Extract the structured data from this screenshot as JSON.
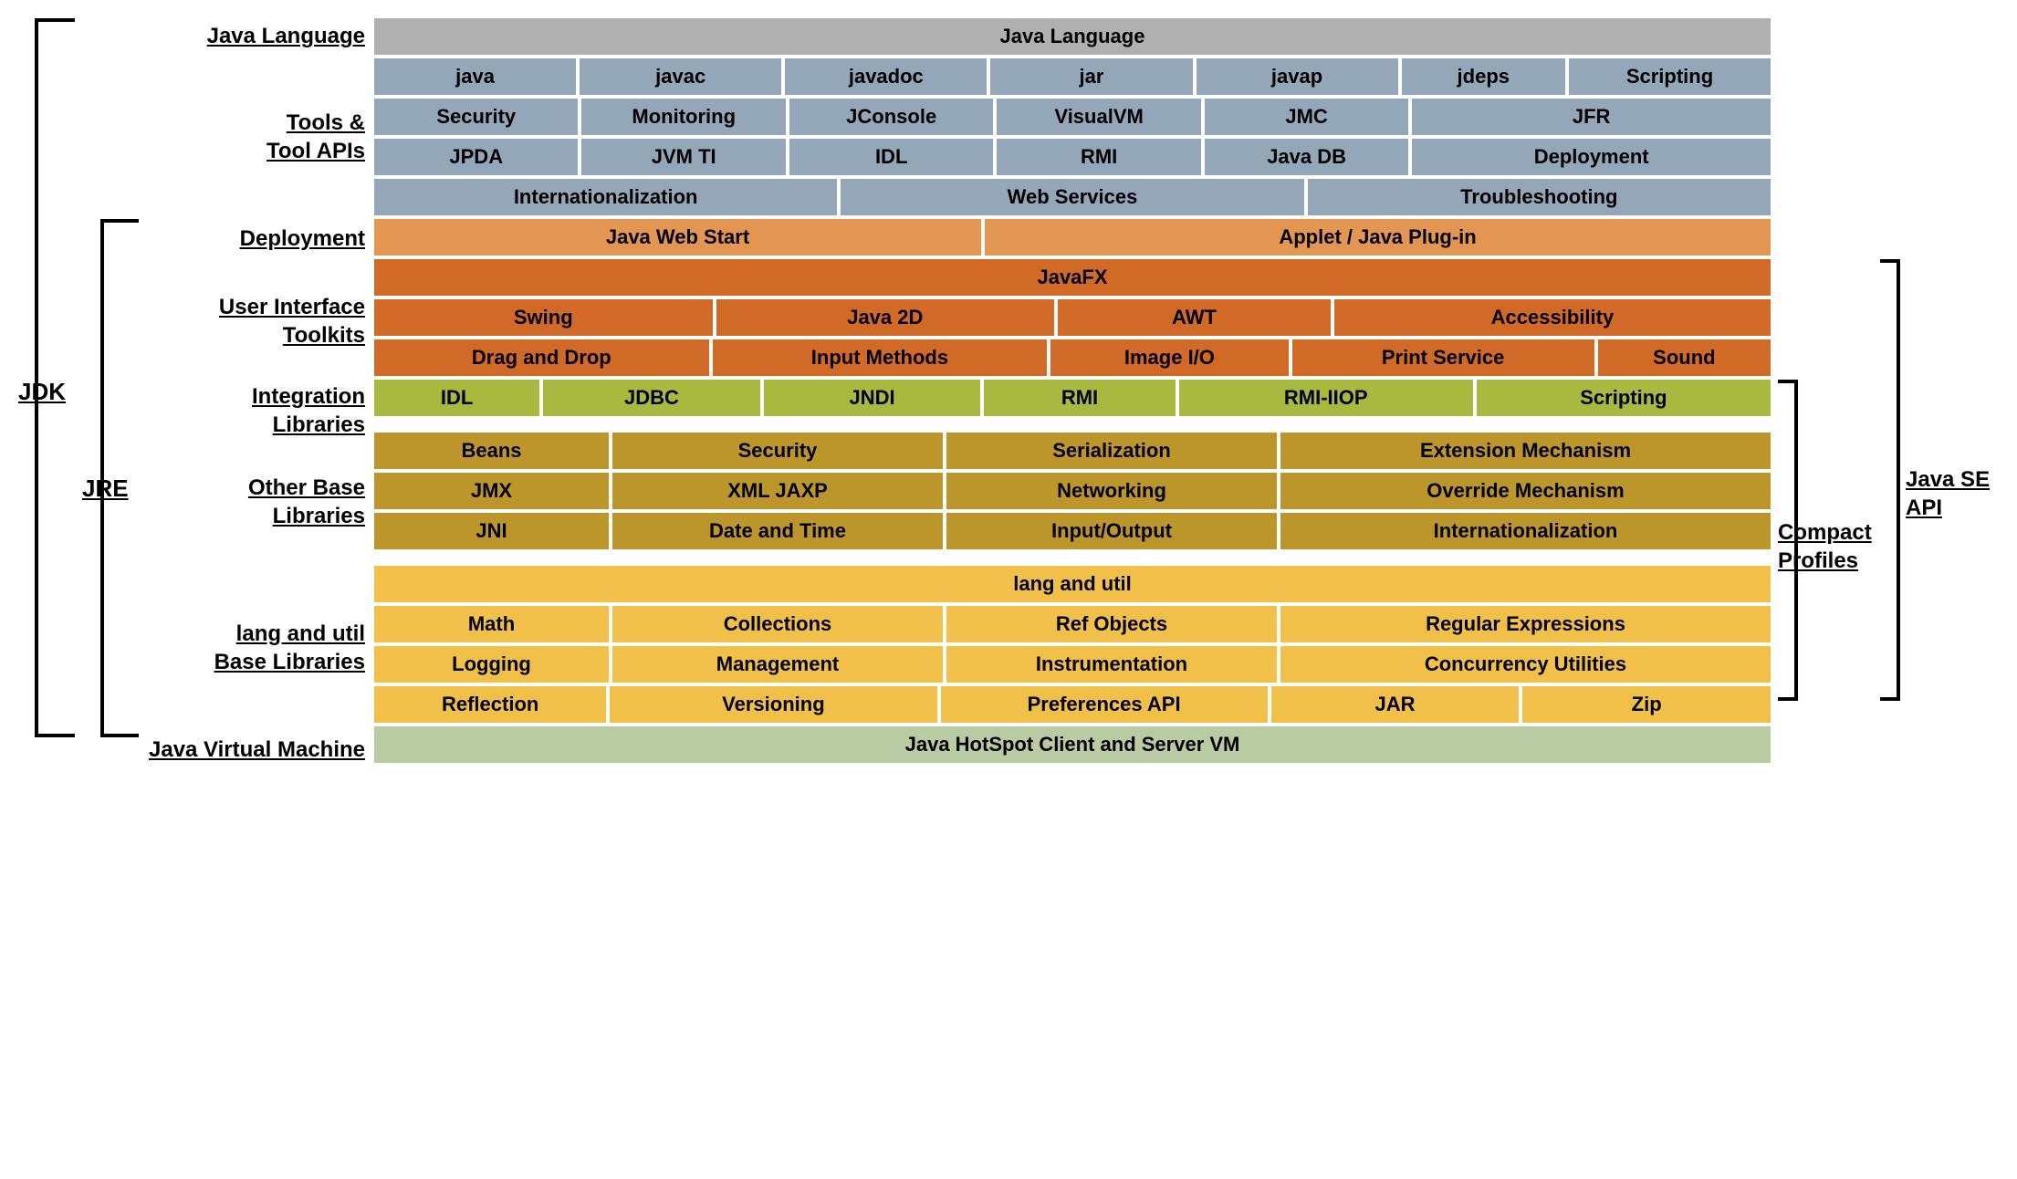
{
  "leftBrackets": {
    "jdk": "JDK",
    "jre": "JRE"
  },
  "rightBrackets": {
    "compact": "Compact Profiles",
    "javase": "Java SE API"
  },
  "sections": {
    "javaLanguage": {
      "label": "Java Language",
      "row1": [
        "Java Language"
      ]
    },
    "toolsApis": {
      "label": "Tools & Tool APIs",
      "row1": [
        "java",
        "javac",
        "javadoc",
        "jar",
        "javap",
        "jdeps",
        "Scripting"
      ],
      "row2": [
        "Security",
        "Monitoring",
        "JConsole",
        "VisualVM",
        "JMC",
        "JFR"
      ],
      "row3": [
        "JPDA",
        "JVM TI",
        "IDL",
        "RMI",
        "Java DB",
        "Deployment"
      ],
      "row4": [
        "Internationalization",
        "Web Services",
        "Troubleshooting"
      ]
    },
    "deployment": {
      "label": "Deployment",
      "row1": [
        "Java Web Start",
        "Applet / Java Plug-in"
      ]
    },
    "uiToolkits": {
      "label": "User Interface Toolkits",
      "row1": [
        "JavaFX"
      ],
      "row2": [
        "Swing",
        "Java 2D",
        "AWT",
        "Accessibility"
      ],
      "row3": [
        "Drag and Drop",
        "Input Methods",
        "Image I/O",
        "Print Service",
        "Sound"
      ]
    },
    "integration": {
      "label": "Integration Libraries",
      "row1": [
        "IDL",
        "JDBC",
        "JNDI",
        "RMI",
        "RMI-IIOP",
        "Scripting"
      ]
    },
    "otherBase": {
      "label": "Other Base Libraries",
      "row1": [
        "Beans",
        "Security",
        "Serialization",
        "Extension Mechanism"
      ],
      "row2": [
        "JMX",
        "XML JAXP",
        "Networking",
        "Override Mechanism"
      ],
      "row3": [
        "JNI",
        "Date and Time",
        "Input/Output",
        "Internationalization"
      ]
    },
    "langUtil": {
      "label": "lang and util Base Libraries",
      "row1": [
        "lang and util"
      ],
      "row2": [
        "Math",
        "Collections",
        "Ref Objects",
        "Regular Expressions"
      ],
      "row3": [
        "Logging",
        "Management",
        "Instrumentation",
        "Concurrency Utilities"
      ],
      "row4": [
        "Reflection",
        "Versioning",
        "Preferences API",
        "JAR",
        "Zip"
      ]
    },
    "jvm": {
      "label": "Java Virtual Machine",
      "row1": [
        "Java HotSpot Client and Server VM"
      ]
    }
  }
}
